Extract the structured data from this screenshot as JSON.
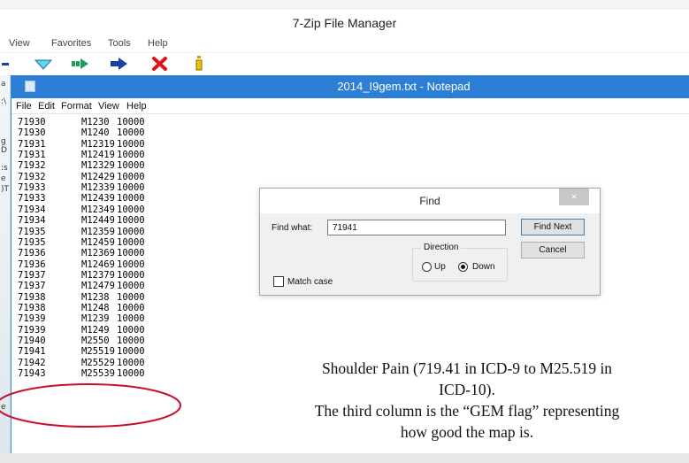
{
  "zip": {
    "title": "7-Zip File Manager",
    "menu": [
      "View",
      "Favorites",
      "Tools",
      "Help"
    ],
    "toolbar_icons": [
      "add-icon",
      "extract-icon",
      "test-icon",
      "copy-icon",
      "move-icon",
      "delete-icon",
      "info-icon"
    ]
  },
  "notepad": {
    "title": "2014_I9gem.txt - Notepad",
    "menu": [
      "File",
      "Edit",
      "Format",
      "View",
      "Help"
    ],
    "lines": [
      [
        "71930",
        "M1230",
        "10000"
      ],
      [
        "71930",
        "M1240",
        "10000"
      ],
      [
        "71931",
        "M12319",
        "10000"
      ],
      [
        "71931",
        "M12419",
        "10000"
      ],
      [
        "71932",
        "M12329",
        "10000"
      ],
      [
        "71932",
        "M12429",
        "10000"
      ],
      [
        "71933",
        "M12339",
        "10000"
      ],
      [
        "71933",
        "M12439",
        "10000"
      ],
      [
        "71934",
        "M12349",
        "10000"
      ],
      [
        "71934",
        "M12449",
        "10000"
      ],
      [
        "71935",
        "M12359",
        "10000"
      ],
      [
        "71935",
        "M12459",
        "10000"
      ],
      [
        "71936",
        "M12369",
        "10000"
      ],
      [
        "71936",
        "M12469",
        "10000"
      ],
      [
        "71937",
        "M12379",
        "10000"
      ],
      [
        "71937",
        "M12479",
        "10000"
      ],
      [
        "71938",
        "M1238",
        "10000"
      ],
      [
        "71938",
        "M1248",
        "10000"
      ],
      [
        "71939",
        "M1239",
        "10000"
      ],
      [
        "71939",
        "M1249",
        "10000"
      ],
      [
        "71940",
        "M2550",
        "10000"
      ],
      [
        "71941",
        "M25519",
        "10000"
      ],
      [
        "71942",
        "M25529",
        "10000"
      ],
      [
        "71943",
        "M25539",
        "10000"
      ]
    ]
  },
  "find_dialog": {
    "title": "Find",
    "close_label": "×",
    "find_what_label": "Find what:",
    "find_what_value": "71941",
    "find_next_label": "Find Next",
    "cancel_label": "Cancel",
    "direction_label": "Direction",
    "up_label": "Up",
    "down_label": "Down",
    "direction_selected": "Down",
    "match_case_label": "Match case",
    "match_case_checked": false
  },
  "caption": {
    "line1": "Shoulder Pain (719.41 in ICD-9 to M25.519 in",
    "line2": "ICD-10).",
    "line3": "The third column is the “GEM flag” representing",
    "line4": "how good the map is."
  },
  "desktop_strip": [
    "a",
    ":\\",
    "g",
    "D",
    ":s",
    "e",
    ")T",
    "e"
  ],
  "colors": {
    "notepad_titlebar": "#2c7fd5",
    "annotation": "#c8102e"
  }
}
